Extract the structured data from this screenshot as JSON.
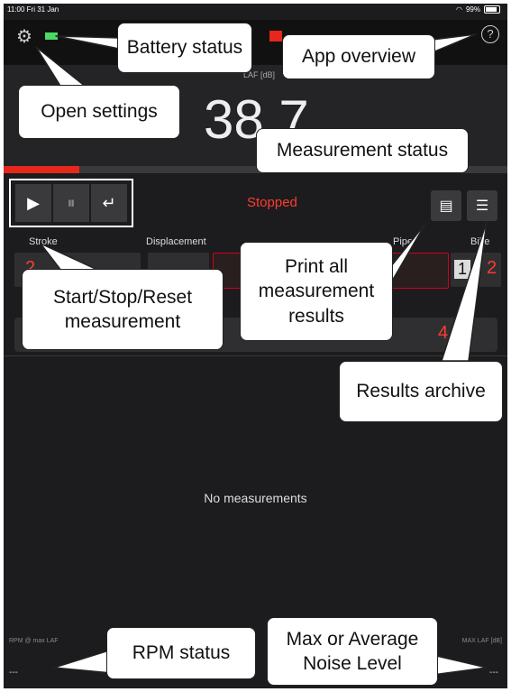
{
  "status_bar": {
    "time": "11:00  Fri 31 Jan",
    "battery": "99%"
  },
  "level": {
    "label": "LAF [dB]",
    "value": "38.7",
    "progress": 0.15
  },
  "state": {
    "text": "Stopped"
  },
  "columns": [
    "Stroke",
    "Displacement",
    "Pipe",
    "Bike"
  ],
  "cells": {
    "stroke": "2",
    "bike_num": "1",
    "bike_val": "2",
    "row2_val": "4"
  },
  "empty_text": "No measurements",
  "footer": {
    "left_label": "RPM @ max LAF",
    "left_value": "---",
    "right_label": "MAX LAF [dB]",
    "right_value": "---"
  },
  "callouts": {
    "battery_status": "Battery status",
    "app_overview": "App overview",
    "open_settings": "Open settings",
    "measurement_status": "Measurement status",
    "print_all": "Print all measurement results",
    "start_stop_reset": "Start/Stop/Reset measurement",
    "results_archive": "Results archive",
    "rpm_status": "RPM status",
    "max_avg_noise": "Max or Average Noise Level"
  },
  "colors": {
    "accent": "#ff3b30",
    "background": "#1c1c1e",
    "battery": "#4cd964"
  },
  "icons": [
    "gear-icon",
    "battery-icon",
    "help-icon",
    "play-icon",
    "pause-icon",
    "reset-icon",
    "print-icon",
    "archive-icon"
  ]
}
